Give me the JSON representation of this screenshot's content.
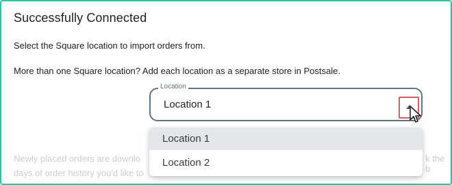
{
  "header": {
    "title": "Successfully Connected"
  },
  "instructions": {
    "line1": "Select the Square location to import orders from.",
    "line2": "More than one Square location? Add each location as a separate store in Postsale."
  },
  "location_select": {
    "label": "Location",
    "value": "Location 1",
    "options": [
      "Location 1",
      "Location 2"
    ],
    "highlighted_option": "Location 1",
    "arrow_icon": "caret-up-icon",
    "highlight_color": "#d95b5b"
  },
  "background_text": {
    "part1": "Newly placed orders are downlo",
    "part2": "days of order history you'd like to",
    "part3": "k the b"
  },
  "theme": {
    "frame_border": "#2ec4a6",
    "select_border": "#5f7482"
  }
}
